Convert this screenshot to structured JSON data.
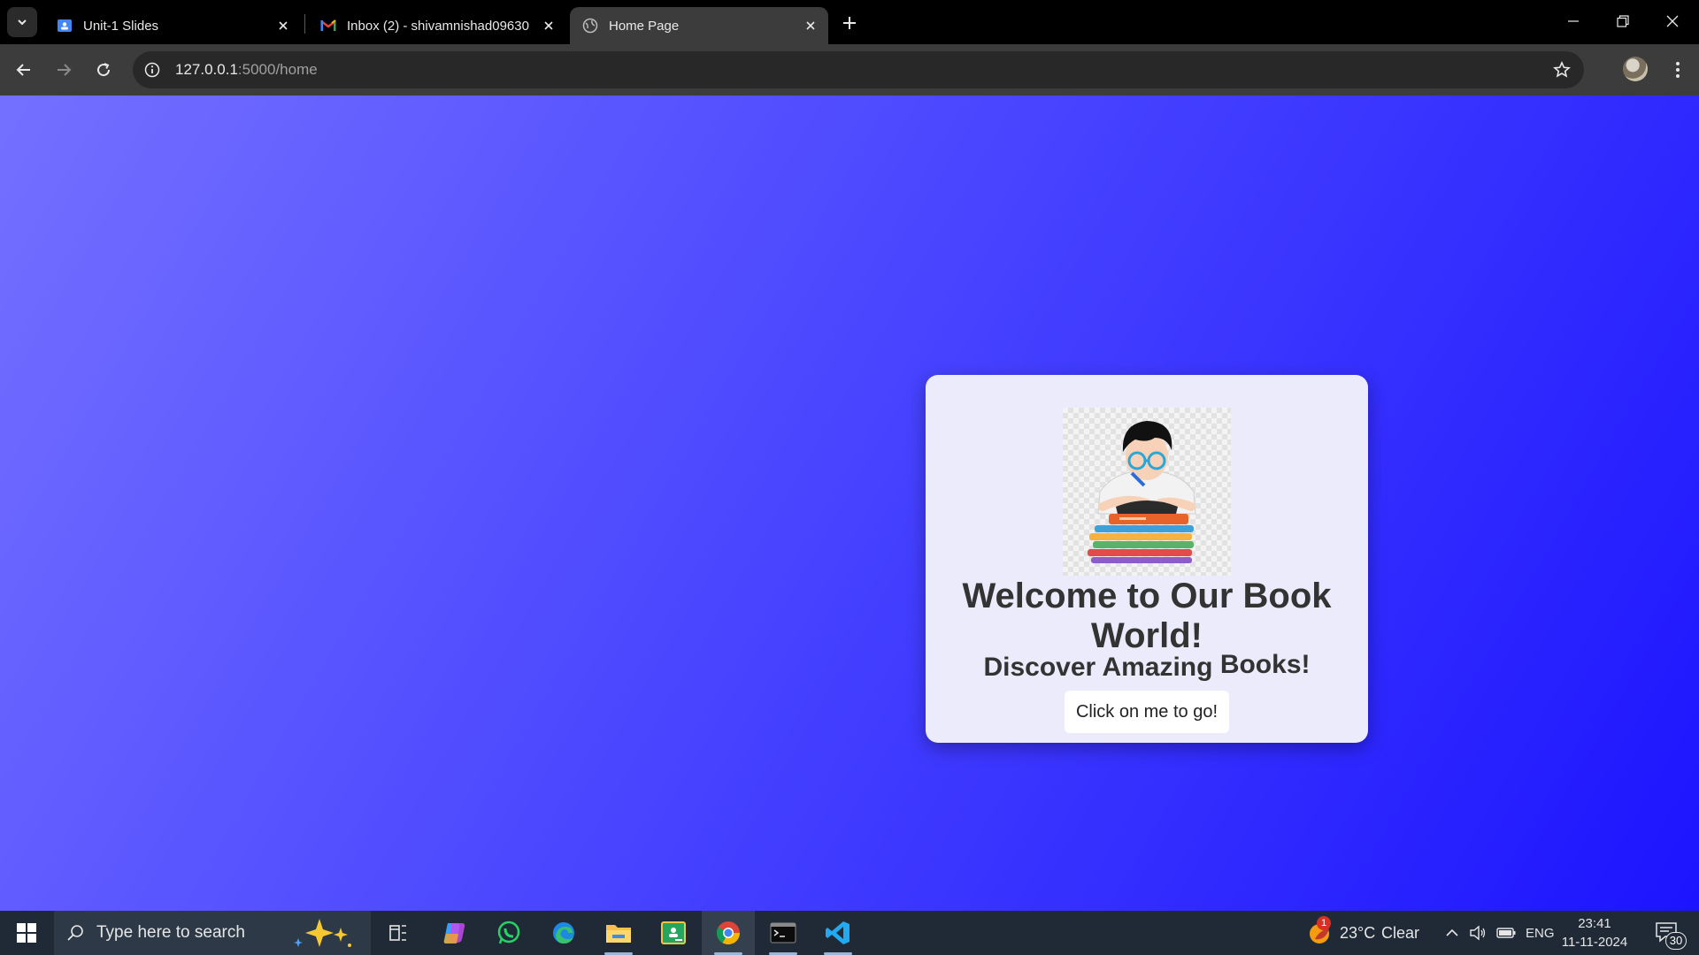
{
  "browser": {
    "tabs": [
      {
        "title": "Unit-1 Slides",
        "icon": "slides-icon",
        "active": false
      },
      {
        "title": "Inbox (2) - shivamnishad09630",
        "icon": "gmail-icon",
        "active": false
      },
      {
        "title": "Home Page",
        "icon": "globe-icon",
        "active": true
      }
    ],
    "url_host": "127.0.0.1",
    "url_path": ":5000/home"
  },
  "page": {
    "heading": "Welcome to Our Book World!",
    "subheading_main": "Discover Amazing",
    "subheading_tail": "Books!",
    "button_label": "Click on me to go!",
    "image_icon": "reading-boy-books-illustration"
  },
  "taskbar": {
    "search_placeholder": "Type here to search",
    "weather_temp": "23°C",
    "weather_text": "Clear",
    "weather_badge": "1",
    "language": "ENG",
    "time": "23:41",
    "date": "11-11-2024",
    "notification_count": "30"
  },
  "colors": {
    "gradient_start": "#7470ff",
    "gradient_end": "#1c14ff",
    "card_bg": "#ecebfb",
    "heading_color": "#333333"
  }
}
